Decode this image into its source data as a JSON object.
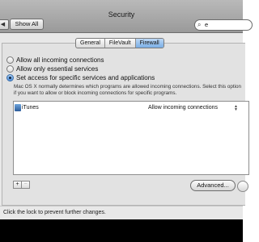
{
  "window": {
    "title": "Security"
  },
  "toolbar": {
    "show_all_label": "Show All",
    "back_glyph": "◀",
    "search_icon": "magnifier-icon",
    "search_value": "e"
  },
  "tabs": [
    {
      "label": "General",
      "active": false
    },
    {
      "label": "FileVault",
      "active": false
    },
    {
      "label": "Firewall",
      "active": true
    }
  ],
  "firewall": {
    "options": [
      {
        "label": "Allow all incoming connections",
        "selected": false
      },
      {
        "label": "Allow only essential services",
        "selected": false
      },
      {
        "label": "Set access for specific services and applications",
        "selected": true
      }
    ],
    "description": "Mac OS X normally determines which programs are allowed incoming connections. Select this option if you want to allow or block incoming connections for specific programs.",
    "apps": [
      {
        "name": "iTunes",
        "access": "Allow incoming connections",
        "icon": "itunes-app-icon"
      }
    ],
    "add_label": "+",
    "remove_label": "−",
    "advanced_label": "Advanced..."
  },
  "footer": {
    "lock_text": "Click the lock to prevent further changes."
  }
}
